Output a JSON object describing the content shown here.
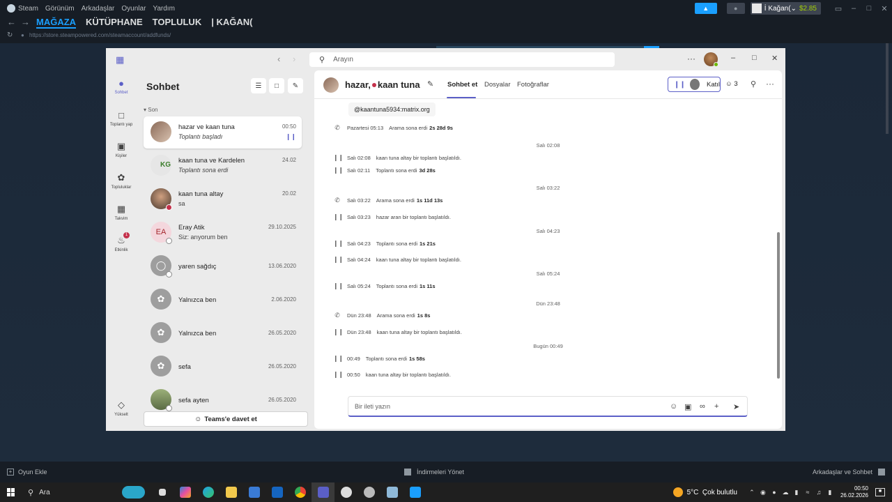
{
  "steam": {
    "menu": [
      "Steam",
      "Görünüm",
      "Arkadaşlar",
      "Oyunlar",
      "Yardım"
    ],
    "user_name": "İ Kağan(",
    "balance": "$2.85",
    "nav_tabs": [
      "MAĞAZA",
      "KÜTÜPHANE",
      "TOPLULUK",
      "| KAĞAN("
    ],
    "url": "https://store.steampowered.com/steamaccount/addfunds/",
    "bottom_add_game": "Oyun Ekle",
    "bottom_downloads": "İndirmeleri Yönet",
    "bottom_friends": "Arkadaşlar ve Sohbet",
    "accent_color": "#1a9fff"
  },
  "teams": {
    "search_placeholder": "Arayın",
    "rail": [
      {
        "label": "Sohbet",
        "icon": "chat-icon"
      },
      {
        "label": "Toplantı yap",
        "icon": "video-icon"
      },
      {
        "label": "Kişiler",
        "icon": "contacts-icon"
      },
      {
        "label": "Topluluklar",
        "icon": "communities-icon"
      },
      {
        "label": "Takvim",
        "icon": "calendar-icon"
      },
      {
        "label": "Etkinlik",
        "icon": "bell-icon",
        "badge": "1"
      },
      {
        "label": "Yükselt",
        "icon": "diamond-icon"
      }
    ],
    "chat_list": {
      "title": "Sohbet",
      "section": "Son",
      "items": [
        {
          "name": "hazar ve kaan tuna",
          "sub": "Toplantı başladı",
          "date": "00:50"
        },
        {
          "name": "kaan tuna ve Kardelen",
          "sub": "Toplantı sona erdi",
          "date": "24.02"
        },
        {
          "name": "kaan tuna altay",
          "sub": "sa",
          "date": "20.02"
        },
        {
          "name": "Eray Atik",
          "sub": "Siz: arıyorum ben",
          "date": "29.10.2025",
          "initials": "EA"
        },
        {
          "name": "yaren sağdıç",
          "sub": "",
          "date": "13.06.2020"
        },
        {
          "name": "Yalnızca ben",
          "sub": "",
          "date": "2.06.2020"
        },
        {
          "name": "Yalnızca ben",
          "sub": "",
          "date": "26.05.2020"
        },
        {
          "name": "sefa",
          "sub": "",
          "date": "26.05.2020"
        },
        {
          "name": "sefa ayten",
          "sub": "",
          "date": "26.05.2020"
        }
      ],
      "invite_label": "Teams'e davet et"
    },
    "chat": {
      "title_a": "hazar,",
      "title_b": "kaan tuna",
      "tabs": [
        "Sohbet et",
        "Dosyalar",
        "Fotoğraflar"
      ],
      "join_label": "Katıl",
      "participants": "3",
      "handle": "@kaantuna5934:matrix.org",
      "events": [
        {
          "type": "call",
          "time": "Pazartesi 05:13",
          "text": "Arama sona erdi",
          "bold": "2s 28d 9s"
        },
        {
          "type": "sep",
          "text": "Salı 02:08"
        },
        {
          "type": "meet",
          "time": "Salı 02:08",
          "text": "kaan tuna altay bir toplantı başlatıldı.",
          "bold": ""
        },
        {
          "type": "meet",
          "time": "Salı 02:11",
          "text": "Toplantı sona erdi",
          "bold": "3d 28s"
        },
        {
          "type": "sep",
          "text": "Salı 03:22"
        },
        {
          "type": "call",
          "time": "Salı 03:22",
          "text": "Arama sona erdi",
          "bold": "1s 11d 13s"
        },
        {
          "type": "meet",
          "time": "Salı 03:23",
          "text": "hazar aran bir toplantı başlatıldı.",
          "bold": ""
        },
        {
          "type": "sep",
          "text": "Salı 04:23"
        },
        {
          "type": "meet",
          "time": "Salı 04:23",
          "text": "Toplantı sona erdi",
          "bold": "1s 21s"
        },
        {
          "type": "meet",
          "time": "Salı 04:24",
          "text": "kaan tuna altay bir toplantı başlatıldı.",
          "bold": ""
        },
        {
          "type": "sep",
          "text": "Salı 05:24"
        },
        {
          "type": "meet",
          "time": "Salı 05:24",
          "text": "Toplantı sona erdi",
          "bold": "1s 11s"
        },
        {
          "type": "sep",
          "text": "Dün 23:48"
        },
        {
          "type": "call",
          "time": "Dün 23:48",
          "text": "Arama sona erdi",
          "bold": "1s 8s"
        },
        {
          "type": "meet",
          "time": "Dün 23:48",
          "text": "kaan tuna altay bir toplantı başlatıldı.",
          "bold": ""
        },
        {
          "type": "sep",
          "text": "Bugün 00:49"
        },
        {
          "type": "meet",
          "time": "00:49",
          "text": "Toplantı sona erdi",
          "bold": "1s 58s"
        },
        {
          "type": "meet",
          "time": "00:50",
          "text": "kaan tuna altay bir toplantı başlatıldı.",
          "bold": ""
        }
      ],
      "compose_placeholder": "Bir ileti yazın"
    },
    "accent_color": "#5b5fc7"
  },
  "taskbar": {
    "search": "Ara",
    "weather": "5°C",
    "weather_desc": "Çok bulutlu",
    "time": "00:50",
    "date": "26.02.2026"
  }
}
